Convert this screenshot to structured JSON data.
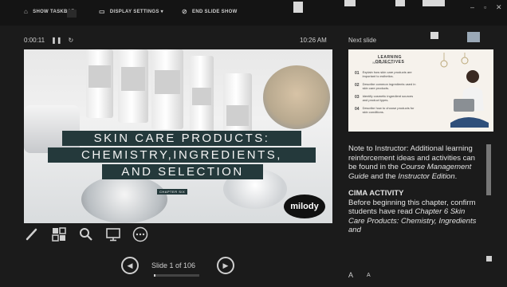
{
  "toolbar": {
    "show_taskbar_label": "SHOW TASKBAR",
    "display_settings_label": "DISPLAY SETTINGS ▾",
    "end_show_label": "END SLIDE SHOW"
  },
  "presenter": {
    "elapsed": "0:00:11",
    "clock": "10:26 AM",
    "slide_counter": "Slide 1 of 106",
    "progress_fraction": 0.0094
  },
  "current_slide": {
    "title_lines": [
      "SKIN CARE PRODUCTS:",
      "CHEMISTRY,INGREDIENTS,",
      "AND SELECTION"
    ],
    "chapter": "CHAPTER SIX",
    "brand": "milody"
  },
  "next_slide": {
    "label": "Next slide",
    "title": "LEARNING OBJECTIVES",
    "subtitle": "What We'll Learn",
    "objectives": [
      {
        "num": "01",
        "text": "Explain how skin care products are important to esthetics."
      },
      {
        "num": "02",
        "text": "Describe common ingredients used in skin care products."
      },
      {
        "num": "03",
        "text": "Identify cosmetic ingredient sources and product types."
      },
      {
        "num": "04",
        "text": "Describe how to choose products for skin conditions."
      }
    ]
  },
  "notes": {
    "p1_a": "Note to Instructor:  Additional learning reinforcement ideas and activities can be found in the ",
    "p1_cmg": "Course Management Guide",
    "p1_b": " and the ",
    "p1_ie": "Instructor Edition",
    "p1_c": ".",
    "heading": "CIMA ACTIVITY",
    "p2_a": "Before beginning this chapter, confirm students have read ",
    "p2_i": "Chapter 6 Skin Care Products: Chemistry, Ingredients and"
  },
  "icons": [
    "pen-icon",
    "slide-grid-icon",
    "zoom-icon",
    "screen-icon",
    "more-options-icon",
    "previous-slide-icon",
    "next-slide-icon"
  ],
  "colors": {
    "background": "#1b1b1b",
    "title_band": "#24393b",
    "text": "#e2e2e2"
  }
}
